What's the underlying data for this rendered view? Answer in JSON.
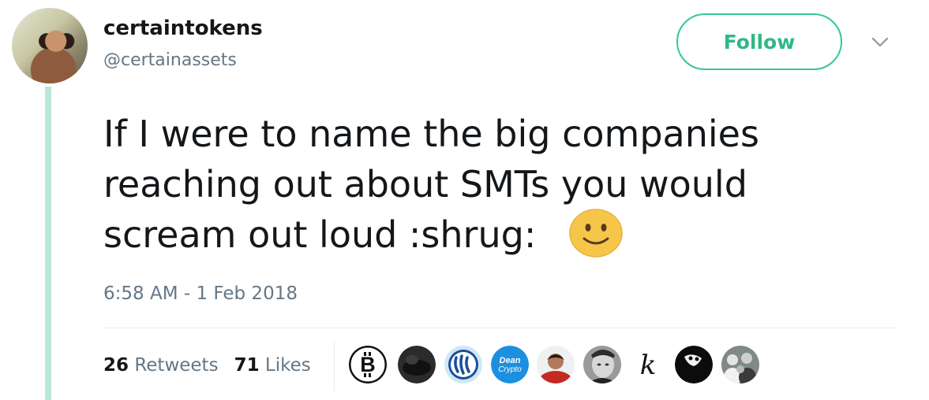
{
  "user": {
    "display_name": "certaintokens",
    "handle": "@certainassets"
  },
  "follow_label": "Follow",
  "tweet": {
    "text": "If I were to name the big companies\nreaching out about SMTs you would\nscream out loud :shrug: ",
    "emoji": "smiling-face-icon",
    "timestamp": "6:58 AM - 1 Feb 2018"
  },
  "stats": {
    "retweets_count": "26",
    "retweets_label": "Retweets",
    "likes_count": "71",
    "likes_label": "Likes"
  },
  "likers": [
    {
      "icon": "bitcoin-logo-icon"
    },
    {
      "icon": "dark-avatar-icon"
    },
    {
      "icon": "steem-logo-icon"
    },
    {
      "icon": "dean-crypto-logo-icon",
      "text_line1": "Dean",
      "text_line2": "Crypto"
    },
    {
      "icon": "red-shirt-person-avatar"
    },
    {
      "icon": "grayscale-face-avatar"
    },
    {
      "icon": "k-logo-icon",
      "text": "k"
    },
    {
      "icon": "black-white-avatar"
    },
    {
      "icon": "group-photo-avatar"
    }
  ],
  "colors": {
    "follow_accent": "#2fb986",
    "thread_line": "#b8e9d6",
    "secondary_text": "#657786",
    "primary_text": "#14171a"
  }
}
